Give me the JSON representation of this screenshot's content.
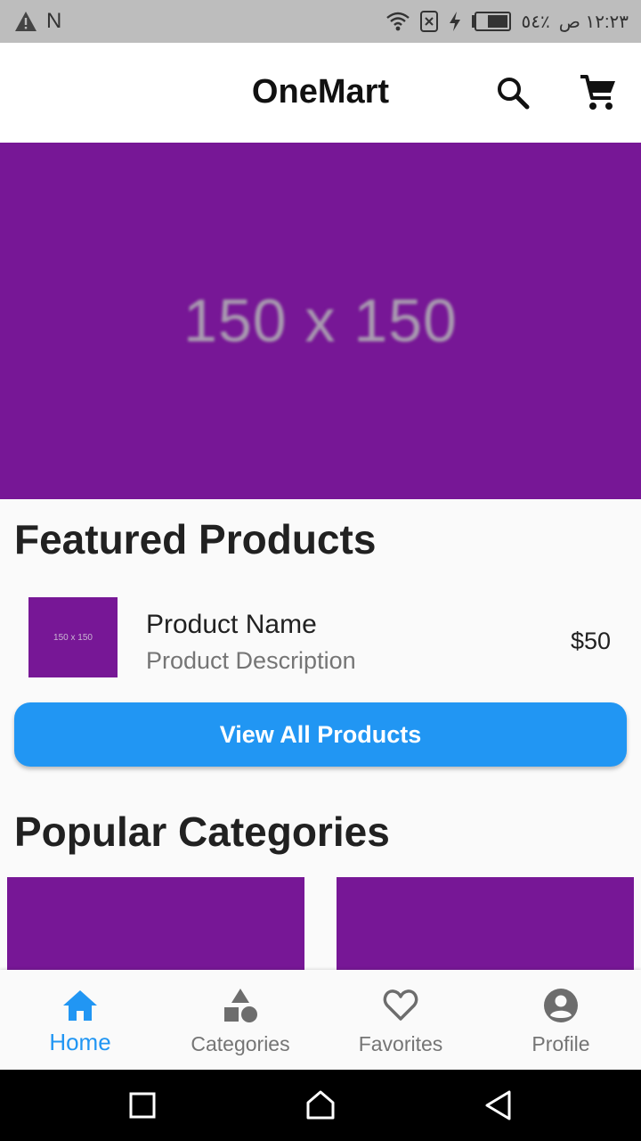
{
  "status_bar": {
    "left_letter": "N",
    "battery_percent": "٥٤٪",
    "time": "١٢:٢٣ ص",
    "icons": [
      "warning-icon",
      "wifi-icon",
      "sim-off-icon",
      "charging-icon",
      "battery-icon"
    ]
  },
  "app_bar": {
    "title": "OneMart",
    "icons": [
      "search-icon",
      "cart-icon"
    ]
  },
  "banner": {
    "placeholder_text": "150 x 150",
    "color": "#771796"
  },
  "featured": {
    "heading": "Featured Products",
    "products": [
      {
        "name": "Product Name",
        "description": "Product Description",
        "price": "$50",
        "thumb_text": "150 x 150"
      }
    ],
    "view_all_label": "View All Products"
  },
  "categories": {
    "heading": "Popular Categories"
  },
  "bottom_nav": {
    "items": [
      {
        "label": "Home",
        "icon": "home-icon",
        "active": true
      },
      {
        "label": "Categories",
        "icon": "categories-icon",
        "active": false
      },
      {
        "label": "Favorites",
        "icon": "heart-icon",
        "active": false
      },
      {
        "label": "Profile",
        "icon": "profile-icon",
        "active": false
      }
    ]
  },
  "system_nav": {
    "icons": [
      "recents-icon",
      "home-outline-icon",
      "back-icon"
    ]
  },
  "colors": {
    "accent": "#2196f3",
    "placeholder_purple": "#771796",
    "inactive": "#757575"
  }
}
